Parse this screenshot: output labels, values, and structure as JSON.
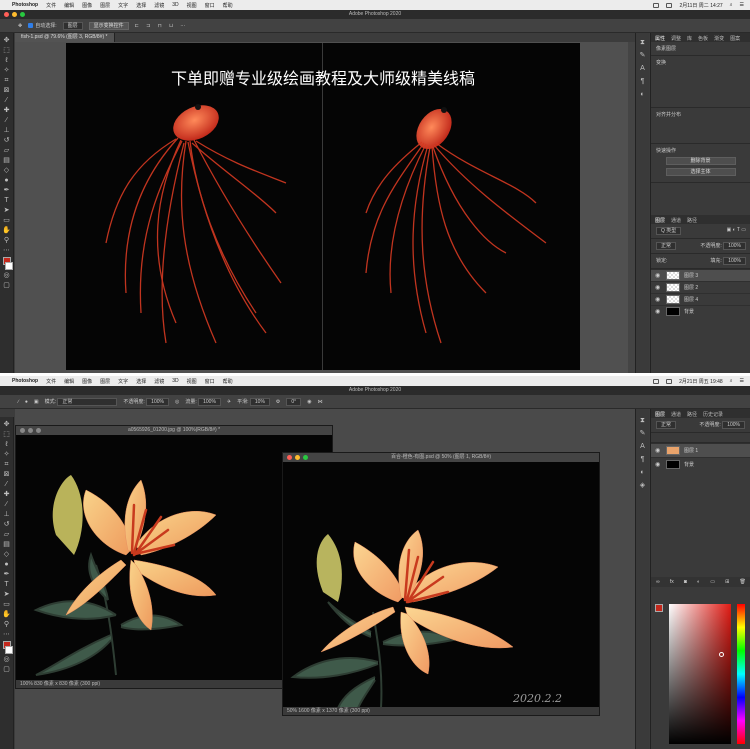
{
  "menubar": {
    "app": "Photoshop",
    "items": [
      "文件",
      "编辑",
      "图像",
      "图层",
      "文字",
      "选择",
      "滤镜",
      "3D",
      "视图",
      "窗口",
      "帮助"
    ],
    "clock_top": "2月11日 周二 14:27",
    "clock_bottom": "2月21日 周五 19:48"
  },
  "window_title": "Adobe Photoshop 2020",
  "top": {
    "options": {
      "auto_select": "自动选择:",
      "auto_select_value": "图层",
      "transform": "显示变换控件"
    },
    "doc_tab": "fish-1.psd @ 79.6% (图层 3, RGB/8#) *",
    "overlay_text": "下单即赠专业级绘画教程及大师级精美线稿",
    "panel_tabs": [
      "属性",
      "调整",
      "库",
      "色板",
      "渐变",
      "图案"
    ],
    "props_label": "像素图层",
    "transform_label": "变换",
    "align_label": "对齐并分布",
    "quick_actions_label": "快速操作",
    "btn_remove_bg": "删除背景",
    "btn_select_subject": "选择主体",
    "layers_tabs": [
      "图层",
      "通道",
      "路径"
    ],
    "kind_label": "Q 类型",
    "mode_label": "正常",
    "opacity_label": "不透明度:",
    "opacity_value": "100%",
    "lock_label": "锁定:",
    "fill_label": "填充:",
    "fill_value": "100%",
    "layers": [
      "图层 3",
      "图层 2",
      "图层 4",
      "背景"
    ]
  },
  "bottom": {
    "options": {
      "mode_label": "模式:",
      "mode_value": "正常",
      "opacity_label": "不透明度:",
      "opacity_value": "100%",
      "flow_label": "流量:",
      "flow_value": "100%",
      "smooth_label": "平滑:",
      "smooth_value": "10%",
      "angle_value": "0°"
    },
    "win1_title": "a0565926_01200.jpg @ 100%(RGB/8#) *",
    "win1_status": "100%    830 像素 x 830 像素 (300 ppi)",
    "win2_title": "百合-橙色-有图.psd @ 50% (图层 1, RGB/8#)",
    "win2_status": "50%    1600 像素 x 1370 像素 (300 ppi)",
    "signature": "2020.2.2",
    "panel_tabs": [
      "图层",
      "通道",
      "路径",
      "历史记录"
    ],
    "mode_label": "正常",
    "opacity_label": "不透明度:",
    "opacity_value": "100%",
    "layers": [
      "图层 1",
      "背景"
    ]
  },
  "colors": {
    "ps_bg": "#3c3c3c",
    "canvas": "#050505",
    "fg_swatch": "#c4281c",
    "accent_blue": "#2f7ee9"
  }
}
